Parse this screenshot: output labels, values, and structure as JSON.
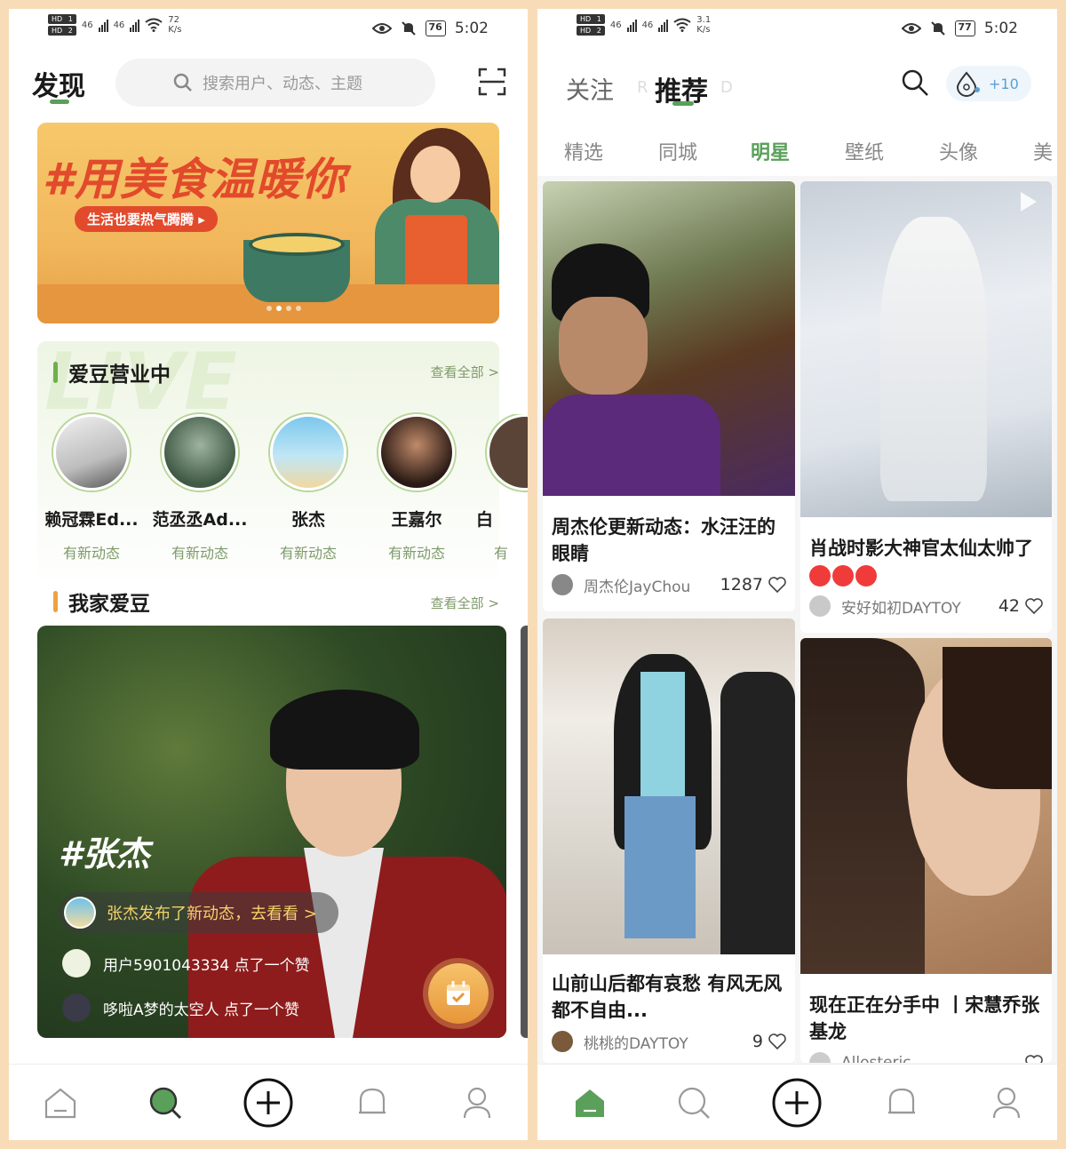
{
  "colors": {
    "accent_green": "#5aa05a",
    "frame": "#f8dcb8",
    "muted_green": "#7e9a6a"
  },
  "left": {
    "status": {
      "hd1": "HD",
      "hd1_n": "1",
      "hd2": "HD",
      "hd2_n": "2",
      "net1": "46",
      "net2": "46",
      "speed": "72",
      "speed_unit": "K/s",
      "battery": "76",
      "time": "5:02"
    },
    "header": {
      "title": "发现",
      "search_placeholder": "搜索用户、动态、主题",
      "icon_search": "search-icon",
      "icon_scan": "scan-icon"
    },
    "banner": {
      "title": "#用美食温暖你",
      "subtitle": "生活也要热气腾腾 ▸"
    },
    "idol_section": {
      "ghost": "LIVE",
      "title": "爱豆营业中",
      "see_all": "查看全部 >",
      "items": [
        {
          "name": "赖冠霖Ed...",
          "status": "有新动态"
        },
        {
          "name": "范丞丞Ad...",
          "status": "有新动态"
        },
        {
          "name": "张杰",
          "status": "有新动态"
        },
        {
          "name": "王嘉尔",
          "status": "有新动态"
        },
        {
          "name": "白",
          "status": "有"
        }
      ]
    },
    "my_idol": {
      "title": "我家爱豆",
      "see_all": "查看全部 >",
      "tag": "#张杰",
      "news": "张杰发布了新动态，去看看 >",
      "likes": [
        {
          "text": "用户5901043334 点了一个赞"
        },
        {
          "text": "哆啦A梦的太空人 点了一个赞"
        }
      ]
    },
    "tabbar": [
      "home-icon",
      "discover-icon",
      "add-icon",
      "notification-icon",
      "profile-icon"
    ]
  },
  "right": {
    "status": {
      "hd1": "HD",
      "hd1_n": "1",
      "hd2": "HD",
      "hd2_n": "2",
      "net1": "46",
      "net2": "46",
      "speed": "3.1",
      "speed_unit": "K/s",
      "battery": "77",
      "time": "5:02"
    },
    "tabs": {
      "follow": "关注",
      "recommend": "推荐",
      "ghost_left": "R",
      "ghost_right": "D"
    },
    "pill_badge": "+10",
    "categories": [
      "精选",
      "同城",
      "明星",
      "壁纸",
      "头像",
      "美"
    ],
    "active_category": "明星",
    "cards": [
      {
        "title": "周杰伦更新动态：水汪汪的眼睛",
        "author": "周杰伦JayChou",
        "likes": "1287"
      },
      {
        "title": "肖战时影大神官太仙太帅了",
        "author": "安好如初DAYTOY",
        "likes": "42"
      },
      {
        "title": "山前山后都有哀愁 有风无风都不自由...",
        "author": "桃桃的DAYTOY",
        "likes": "9"
      },
      {
        "title": "现在正在分手中 丨宋慧乔张基龙",
        "author": "Allosteric",
        "likes": ""
      }
    ]
  }
}
